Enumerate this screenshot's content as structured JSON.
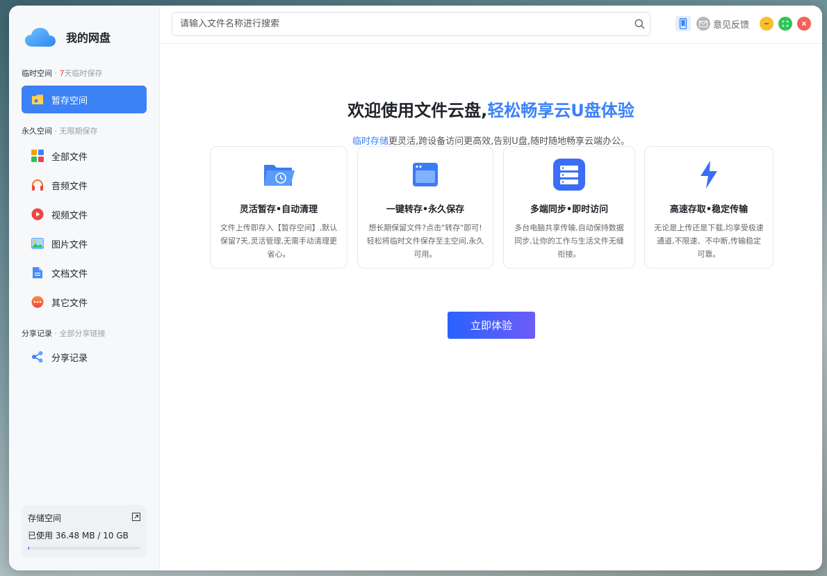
{
  "app": {
    "title": "我的网盘"
  },
  "sidebar": {
    "temp_section": {
      "label": "临时空间",
      "sep": " · ",
      "days": "7",
      "note": "天临时保存"
    },
    "temp_items": [
      {
        "label": "暂存空间",
        "icon": "folder-icon",
        "active": true
      }
    ],
    "perm_section": {
      "label": "永久空间",
      "note": " · 无限期保存"
    },
    "perm_items": [
      {
        "label": "全部文件",
        "icon": "grid-icon"
      },
      {
        "label": "音频文件",
        "icon": "headphones-icon"
      },
      {
        "label": "视频文件",
        "icon": "video-play-icon"
      },
      {
        "label": "图片文件",
        "icon": "image-icon"
      },
      {
        "label": "文档文件",
        "icon": "document-icon"
      },
      {
        "label": "其它文件",
        "icon": "more-icon"
      }
    ],
    "share_section": {
      "label": "分享记录",
      "note": " · 全部分享链接"
    },
    "share_items": [
      {
        "label": "分享记录",
        "icon": "share-icon"
      }
    ],
    "storage": {
      "title": "存储空间",
      "used_text": "已使用 36.48 MB / 10 GB",
      "used_fraction": 0.0036
    }
  },
  "search": {
    "placeholder": "请输入文件名称进行搜索"
  },
  "topbar": {
    "feedback_label": "意见反馈"
  },
  "welcome": {
    "headline_part1": "欢迎使用文件云盘,",
    "headline_part2": "轻松畅享云U盘体验",
    "sub_highlight": "临时存储",
    "sub_rest": "更灵活,跨设备访问更高效,告别U盘,随时随地畅享云端办公。"
  },
  "features": [
    {
      "title": "灵活暂存•自动清理",
      "desc": "文件上传即存入【暂存空间】,默认保留7天,灵活管理,无需手动清理更省心。",
      "icon": "clock-folder-icon"
    },
    {
      "title": "一键转存•永久保存",
      "desc": "想长期保留文件?点击\"转存\"即可!轻松将临时文件保存至主空间,永久可用。",
      "icon": "window-icon"
    },
    {
      "title": "多端同步•即时访问",
      "desc": "多台电脑共享传输,自动保持数据同步,让你的工作与生活文件无缝衔接。",
      "icon": "server-icon"
    },
    {
      "title": "高速存取•稳定传输",
      "desc": "无论是上传还是下载,均享受极速通道,不限速、不中断,传输稳定可靠。",
      "icon": "lightning-icon"
    }
  ],
  "cta": {
    "label": "立即体验"
  },
  "colors": {
    "accent": "#3b82f6",
    "danger": "#e0403c"
  }
}
